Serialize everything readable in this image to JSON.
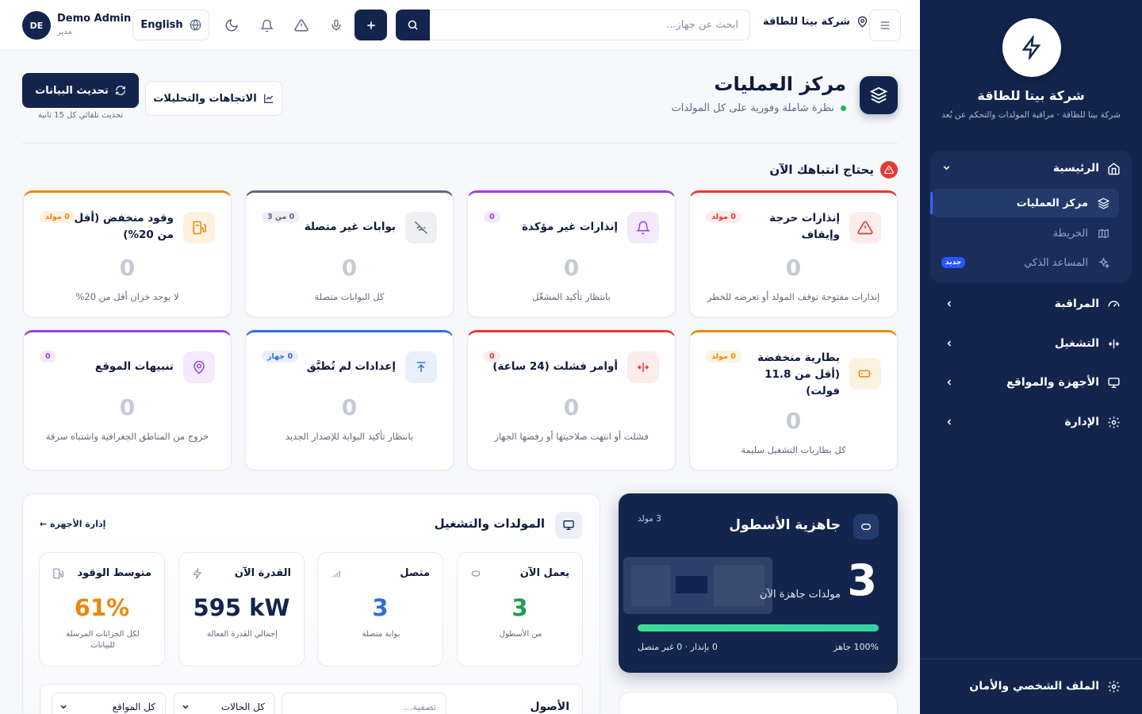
{
  "topbar": {
    "avatar_initials": "DE",
    "user_name": "Demo Admin",
    "user_role": "مدير",
    "language": "English",
    "search_placeholder": "ابحث عن جهاز...",
    "company": "شركة بيتا للطاقة"
  },
  "header": {
    "title": "مركز العمليات",
    "subtitle": "نظرة شاملة وفورية على كل المولدات",
    "refresh_label": "تحديث البيانات",
    "refresh_note": "تحديث تلقائي كل 15 ثانية",
    "trends_label": "الاتجاهات والتحليلات"
  },
  "attention": {
    "title": "يحتاج انتباهك الآن",
    "cards": [
      {
        "title": "إنذارات حرجة وإيقاف",
        "badge": "0 مولد",
        "value": "0",
        "desc": "إنذارات مفتوحة توقف المولد أو تعرضه للخطر",
        "color": "#e53935",
        "icon": "alert-triangle-icon"
      },
      {
        "title": "إنذارات غير مؤكدة",
        "badge": "0",
        "value": "0",
        "desc": "بانتظار تأكيد المشغّل",
        "color": "#9b3fe0",
        "icon": "bell-icon"
      },
      {
        "title": "بوابات غير متصلة",
        "badge": "0 من 3",
        "value": "0",
        "desc": "كل البوابات متصلة",
        "color": "#5d6880",
        "icon": "wifi-off-icon"
      },
      {
        "title": "وقود منخفض (أقل من 20%)",
        "badge": "0 مولد",
        "value": "0",
        "desc": "لا يوجد خزان أقل من 20%",
        "color": "#e8890c",
        "icon": "fuel-icon"
      },
      {
        "title": "بطارية منخفضة (أقل من 11.8 فولت)",
        "badge": "0 مولد",
        "value": "0",
        "desc": "كل بطاريات التشغيل سليمة",
        "color": "#e8890c",
        "icon": "battery-low-icon"
      },
      {
        "title": "أوامر فشلت (24 ساعة)",
        "badge": "0",
        "value": "0",
        "desc": "فشلت أو انتهت صلاحيتها أو رفضها الجهاز",
        "color": "#e53935",
        "icon": "command-failed-icon"
      },
      {
        "title": "إعدادات لم تُطبَّق",
        "badge": "0 جهاز",
        "value": "0",
        "desc": "بانتظار تأكيد البوابة للإصدار الجديد",
        "color": "#2f6fdb",
        "icon": "upload-icon"
      },
      {
        "title": "تنبيهات الموقع",
        "badge": "0",
        "value": "0",
        "desc": "خروج من المناطق الجغرافية واشتباه سرقة",
        "color": "#9b3fe0",
        "icon": "map-pin-icon"
      }
    ]
  },
  "generators": {
    "title": "المولدات والتشغيل",
    "manage_link": "إدارة الأجهزة ←",
    "stats": [
      {
        "label": "يعمل الآن",
        "value": "3",
        "sub": "من الأسطول",
        "color": "#1e9e50"
      },
      {
        "label": "متصل",
        "value": "3",
        "sub": "بوابة متصلة",
        "color": "#2f6fdb"
      },
      {
        "label": "القدرة الآن",
        "value": "595 kW",
        "sub": "إجمالي القدرة الفعالة",
        "color": "#13254d"
      },
      {
        "label": "متوسط الوقود",
        "value": "61%",
        "sub": "لكل الخزانات المرسلة للبيانات",
        "color": "#e8890c"
      }
    ],
    "assets": {
      "title": "الأصول",
      "filter_placeholder": "تصفية...",
      "status_select": "كل الحالات",
      "site_select": "كل المواقع"
    }
  },
  "fleet": {
    "title": "جاهزية الأسطول",
    "count": "3 مولد",
    "big_value": "3",
    "label": "مولدات جاهزة الآن",
    "ready_text": "100% جاهز",
    "state_text": "0 بإنذار · 0 غير متصل",
    "readiness_fraction": 1.0
  },
  "sidebar": {
    "company": "شركة بيتا للطاقة",
    "description": "شركة بيتا للطاقة · مراقبة المولدات والتحكم عن بُعد",
    "home": "الرئيسية",
    "sub_items": [
      {
        "label": "مركز العمليات",
        "icon": "layers-icon"
      },
      {
        "label": "الخريطة",
        "icon": "map-icon"
      },
      {
        "label": "المساعد الذكي",
        "icon": "sparkles-icon",
        "badge": "جديد"
      }
    ],
    "items": [
      {
        "label": "المراقبة",
        "icon": "gauge-icon"
      },
      {
        "label": "التشغيل",
        "icon": "operation-icon"
      },
      {
        "label": "الأجهزة والمواقع",
        "icon": "monitor-icon"
      },
      {
        "label": "الإدارة",
        "icon": "settings-icon"
      }
    ],
    "profile": "الملف الشخصي والأمان"
  },
  "colors": {
    "primary": "#13254d",
    "danger": "#e53935",
    "success": "#1e9e50",
    "warning": "#e8890c",
    "info": "#2f6fdb",
    "purple": "#9b3fe0"
  }
}
